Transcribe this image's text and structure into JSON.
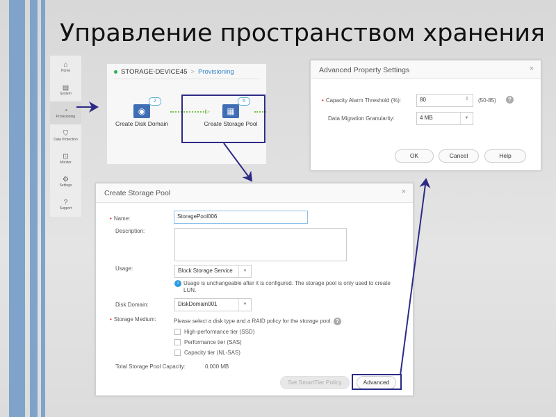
{
  "slide_title": "Управление пространством хранения",
  "sidebar": [
    {
      "icon": "home-icon",
      "label": "Home"
    },
    {
      "icon": "system-icon",
      "label": "System"
    },
    {
      "icon": "provisioning-icon",
      "label": "Provisioning"
    },
    {
      "icon": "shield-icon",
      "label": "Data Protection"
    },
    {
      "icon": "monitor-icon",
      "label": "Monitor"
    },
    {
      "icon": "gear-icon",
      "label": "Settings"
    },
    {
      "icon": "help-icon",
      "label": "Support"
    }
  ],
  "provisioning": {
    "device": "STORAGE-DEVICE45",
    "separator": ">",
    "section": "Provisioning",
    "steps": [
      {
        "label": "Create Disk Domain",
        "count": "2"
      },
      {
        "label": "Create Storage Pool",
        "count": "5"
      }
    ]
  },
  "advanced_dialog": {
    "title": "Advanced Property Settings",
    "close": "×",
    "alarm_label": "Capacity Alarm Threshold (%):",
    "alarm_value": "80",
    "alarm_range": "(50-85)",
    "granularity_label": "Data Migration Granularity:",
    "granularity_value": "4 MB",
    "ok": "OK",
    "cancel": "Cancel",
    "help": "Help"
  },
  "pool_dialog": {
    "title": "Create Storage Pool",
    "close": "×",
    "name_label": "Name:",
    "name_value": "StoragePool006",
    "description_label": "Description:",
    "description_value": "",
    "usage_label": "Usage:",
    "usage_value": "Block Storage Service",
    "usage_note": "Usage is unchangeable after it is configured. The storage pool is only used to create LUN.",
    "disk_domain_label": "Disk Domain:",
    "disk_domain_value": "DiskDomain001",
    "medium_label": "Storage Medium:",
    "medium_hint": "Please select a disk type and a RAID policy for the storage pool.",
    "tiers": [
      "High-performance tier (SSD)",
      "Performance tier (SAS)",
      "Capacity tier (NL-SAS)"
    ],
    "capacity_label": "Total Storage Pool Capacity:",
    "capacity_value": "0.000 MB",
    "smarttier_button": "Set SmartTier Policy",
    "advanced_button": "Advanced"
  }
}
